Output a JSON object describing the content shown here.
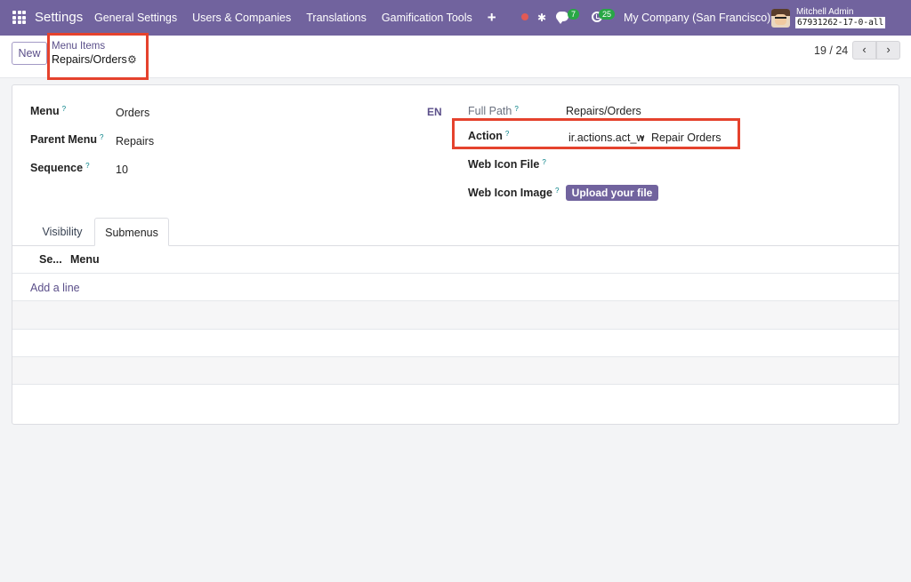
{
  "navbar": {
    "app_name": "Settings",
    "menu": [
      "General Settings",
      "Users & Companies",
      "Translations",
      "Gamification Tools"
    ],
    "plus": "+",
    "messages_count": "7",
    "activities_count": "25",
    "company": "My Company (San Francisco)",
    "user_name": "Mitchell Admin",
    "database": "67931262-17-0-all"
  },
  "control": {
    "new_label": "New",
    "breadcrumb_parent": "Menu Items",
    "breadcrumb_current": "Repairs/Orders",
    "pager_value": "19 / 24",
    "prev_glyph": "‹",
    "next_glyph": "›"
  },
  "form": {
    "menu_label": "Menu",
    "menu_value": "Orders",
    "parent_label": "Parent Menu",
    "parent_value": "Repairs",
    "sequence_label": "Sequence",
    "sequence_value": "10",
    "lang_code": "EN",
    "full_path_label": "Full Path",
    "full_path_value": "Repairs/Orders",
    "action_label": "Action",
    "action_model": "ir.actions.act_window",
    "action_value": "Repair Orders",
    "icon_file_label": "Web Icon File",
    "icon_image_label": "Web Icon Image",
    "upload_label": "Upload your file",
    "help_mark": "?"
  },
  "tabs": {
    "visibility": "Visibility",
    "submenus": "Submenus"
  },
  "submenu_table": {
    "col_sequence": "Se...",
    "col_menu": "Menu",
    "add_line": "Add a line"
  },
  "colors": {
    "brand": "#71639e",
    "highlight": "#e5422d",
    "badge": "#28a745"
  }
}
